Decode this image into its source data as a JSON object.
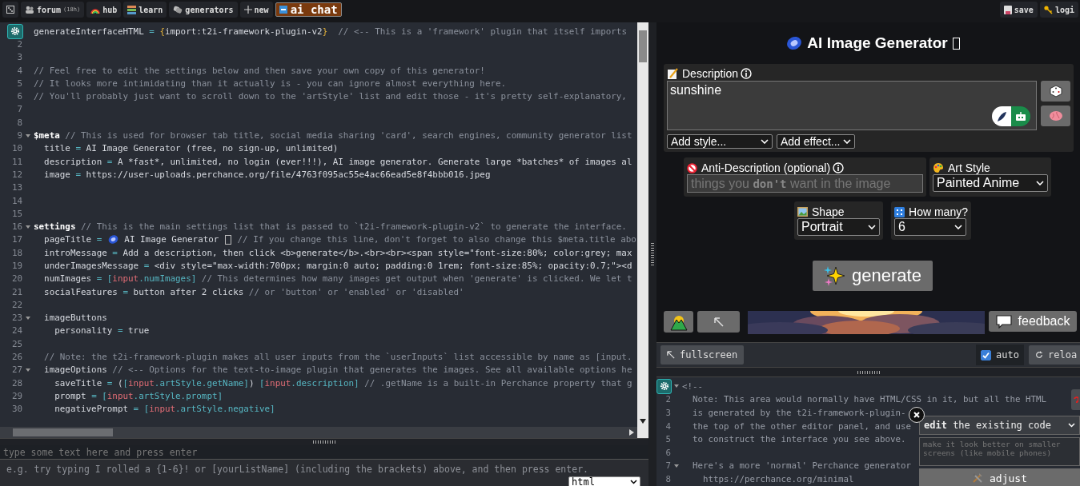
{
  "topbar": {
    "links": [
      {
        "label": "forum",
        "note": "(18h)",
        "selected": false
      },
      {
        "label": "hub",
        "selected": false
      },
      {
        "label": "learn",
        "selected": false
      },
      {
        "label": "generators",
        "selected": false
      },
      {
        "label": "new",
        "selected": false
      },
      {
        "label": "ai chat",
        "selected": true
      }
    ],
    "actions": [
      {
        "label": "save"
      },
      {
        "label": "logi"
      }
    ]
  },
  "code_editor": {
    "lines": [
      {
        "tokens": [
          {
            "kind": "plain",
            "text": "generateInterfaceHTML"
          },
          {
            "kind": "op",
            "text": " = "
          },
          {
            "kind": "brace",
            "text": "{"
          },
          {
            "kind": "plain",
            "text": "import:t2i-framework-plugin-v2"
          },
          {
            "kind": "brace",
            "text": "}"
          },
          {
            "kind": "comment",
            "text": "  // <-- This is a 'framework' plugin that itself imports"
          }
        ]
      },
      {
        "n": "2"
      },
      {
        "n": "3"
      },
      {
        "n": "4",
        "tokens": [
          {
            "kind": "comment",
            "text": "// Feel free to edit the settings below and then save your own copy of this generator!"
          }
        ]
      },
      {
        "n": "5",
        "tokens": [
          {
            "kind": "comment",
            "text": "// It looks more intimidating than it actually is - you can ignore almost everything here."
          }
        ]
      },
      {
        "n": "6",
        "tokens": [
          {
            "kind": "comment",
            "text": "// You'll probably just want to scroll down to the 'artStyle' list and edit those - it's pretty self-explanatory,"
          }
        ]
      },
      {
        "n": "7"
      },
      {
        "n": "8"
      },
      {
        "n": "9",
        "expanded": true,
        "tokens": [
          {
            "kind": "key",
            "text": "$meta"
          },
          {
            "kind": "comment",
            "text": " // This is used for browser tab title, social media sharing 'card', search engines, community generator list"
          }
        ]
      },
      {
        "n": "10",
        "tokens": [
          {
            "kind": "plain",
            "text": "  title"
          },
          {
            "kind": "op",
            "text": " = "
          },
          {
            "kind": "plain",
            "text": "AI Image Generator (free, no sign-up, unlimited)"
          }
        ]
      },
      {
        "n": "11",
        "tokens": [
          {
            "kind": "plain",
            "text": "  description"
          },
          {
            "kind": "op",
            "text": " = "
          },
          {
            "kind": "plain",
            "text": "A *fast*, unlimited, no login (ever!!!), AI image generator. Generate large *batches* of images al"
          }
        ]
      },
      {
        "n": "12",
        "tokens": [
          {
            "kind": "plain",
            "text": "  image"
          },
          {
            "kind": "op",
            "text": " = "
          },
          {
            "kind": "plain",
            "text": "https://user-uploads.perchance.org/file/4763f095ac55e4ac66ead5e8f4bbb016.jpeg"
          }
        ]
      },
      {
        "n": "13"
      },
      {
        "n": "14"
      },
      {
        "n": "15"
      },
      {
        "n": "16",
        "expanded": true,
        "tokens": [
          {
            "kind": "key",
            "text": "settings"
          },
          {
            "kind": "comment",
            "text": " // This is the main settings list that is passed to `t2i-framework-plugin-v2` to generate the interface."
          }
        ]
      },
      {
        "n": "17",
        "tokens": [
          {
            "kind": "plain",
            "text": "  pageTitle"
          },
          {
            "kind": "op",
            "text": " = "
          },
          {
            "kind": "icon"
          },
          {
            "kind": "plain",
            "text": " AI Image Generator "
          },
          {
            "kind": "missing"
          },
          {
            "kind": "comment",
            "text": " // If you change this line, don't forget to also change this $meta.title abo"
          }
        ]
      },
      {
        "n": "18",
        "tokens": [
          {
            "kind": "plain",
            "text": "  introMessage"
          },
          {
            "kind": "op",
            "text": " = "
          },
          {
            "kind": "plain",
            "text": "Add a description, then click <b>generate</b>.<br><br><span style=\"font-size:80%; color:grey; max"
          }
        ]
      },
      {
        "n": "19",
        "tokens": [
          {
            "kind": "plain",
            "text": "  underImagesMessage"
          },
          {
            "kind": "op",
            "text": " = "
          },
          {
            "kind": "plain",
            "text": "<div style=\"max-width:700px; margin:0 auto; padding:0 1rem; font-size:85%; opacity:0.7;\"><d"
          }
        ]
      },
      {
        "n": "20",
        "tokens": [
          {
            "kind": "plain",
            "text": "  numImages"
          },
          {
            "kind": "op",
            "text": " = "
          },
          {
            "kind": "prop",
            "text": "["
          },
          {
            "kind": "var",
            "text": "input"
          },
          {
            "kind": "prop",
            "text": ".numImages]"
          },
          {
            "kind": "comment",
            "text": " // This determines how many images get output when 'generate' is clicked. We let t"
          }
        ]
      },
      {
        "n": "21",
        "tokens": [
          {
            "kind": "plain",
            "text": "  socialFeatures"
          },
          {
            "kind": "op",
            "text": " = "
          },
          {
            "kind": "plain",
            "text": "button after 2 clicks"
          },
          {
            "kind": "comment",
            "text": " // or 'button' or 'enabled' or 'disabled'"
          }
        ]
      },
      {
        "n": "22"
      },
      {
        "n": "23",
        "expanded": true,
        "tokens": [
          {
            "kind": "plain",
            "text": "  imageButtons"
          }
        ]
      },
      {
        "n": "24",
        "tokens": [
          {
            "kind": "plain",
            "text": "    personality"
          },
          {
            "kind": "op",
            "text": " = "
          },
          {
            "kind": "plain",
            "text": "true"
          }
        ]
      },
      {
        "n": "25"
      },
      {
        "n": "26",
        "tokens": [
          {
            "kind": "comment",
            "text": "  // Note: the t2i-framework-plugin makes all user inputs from the `userInputs` list accessible by name as [input."
          }
        ]
      },
      {
        "n": "27",
        "expanded": true,
        "tokens": [
          {
            "kind": "plain",
            "text": "  imageOptions"
          },
          {
            "kind": "comment",
            "text": " // <-- Options for the text-to-image plugin that generates the images. See all available options he"
          }
        ]
      },
      {
        "n": "28",
        "tokens": [
          {
            "kind": "plain",
            "text": "    saveTitle"
          },
          {
            "kind": "op",
            "text": " = "
          },
          {
            "kind": "plain",
            "text": "("
          },
          {
            "kind": "prop",
            "text": "["
          },
          {
            "kind": "var",
            "text": "input"
          },
          {
            "kind": "prop",
            "text": ".artStyle.getName]"
          },
          {
            "kind": "plain",
            "text": ") "
          },
          {
            "kind": "prop",
            "text": "["
          },
          {
            "kind": "var",
            "text": "input"
          },
          {
            "kind": "prop",
            "text": ".description]"
          },
          {
            "kind": "comment",
            "text": " // .getName is a built-in Perchance property that g"
          }
        ]
      },
      {
        "n": "29",
        "tokens": [
          {
            "kind": "plain",
            "text": "    prompt"
          },
          {
            "kind": "op",
            "text": " = "
          },
          {
            "kind": "prop",
            "text": "["
          },
          {
            "kind": "var",
            "text": "input"
          },
          {
            "kind": "prop",
            "text": ".artStyle.prompt]"
          }
        ]
      },
      {
        "n": "30",
        "tokens": [
          {
            "kind": "plain",
            "text": "    negativePrompt"
          },
          {
            "kind": "op",
            "text": " = "
          },
          {
            "kind": "prop",
            "text": "["
          },
          {
            "kind": "var",
            "text": "input"
          },
          {
            "kind": "prop",
            "text": ".artStyle.negative]"
          }
        ]
      }
    ]
  },
  "console": {
    "input_placeholder": "type some text here and press enter",
    "output": "e.g. try typing I rolled a {1-6}! or [yourListName] (including the brackets) above, and then press enter.",
    "mode": "html"
  },
  "preview": {
    "title": "AI Image Generator",
    "description": {
      "label": "Description",
      "value": "sunshine",
      "modes": [
        {
          "selected": false
        },
        {
          "selected": true
        }
      ],
      "style_select": "Add style...",
      "effect_select": "Add effect..."
    },
    "anti_description": {
      "label": "Anti-Description (optional)",
      "placeholder": "things you **don't** want in the image"
    },
    "art_style": {
      "label": "Art Style",
      "value": "Painted Anime"
    },
    "shape": {
      "label": "Shape",
      "value": "Portrait"
    },
    "count": {
      "label": "How many?",
      "value": "6"
    },
    "generate": "generate",
    "feedback": "feedback",
    "toolbar": {
      "fullscreen": "fullscreen",
      "auto": {
        "label": "auto",
        "checked": true
      },
      "reload": "reloa"
    }
  },
  "html_editor": {
    "lines": [
      {
        "expanded": true,
        "text": "<!--"
      },
      {
        "n": "2",
        "text": "  Note: This area would normally have HTML/CSS in it, but all the HTML"
      },
      {
        "n": "3",
        "text": "  is generated by the t2i-framework-plugin-"
      },
      {
        "n": "4",
        "text": "  the top of the other editor panel, and use"
      },
      {
        "n": "5",
        "text": "  to construct the interface you see above."
      },
      {
        "n": "6"
      },
      {
        "n": "7",
        "expanded": true,
        "text": "  Here's a more 'normal' Perchance generator"
      },
      {
        "n": "8",
        "text": "    https://perchance.org/minimal"
      }
    ],
    "assistant": {
      "mode": "**edit** the existing code",
      "placeholder": "make it look better on smaller screens (like mobile phones)",
      "button": "adjust"
    }
  }
}
